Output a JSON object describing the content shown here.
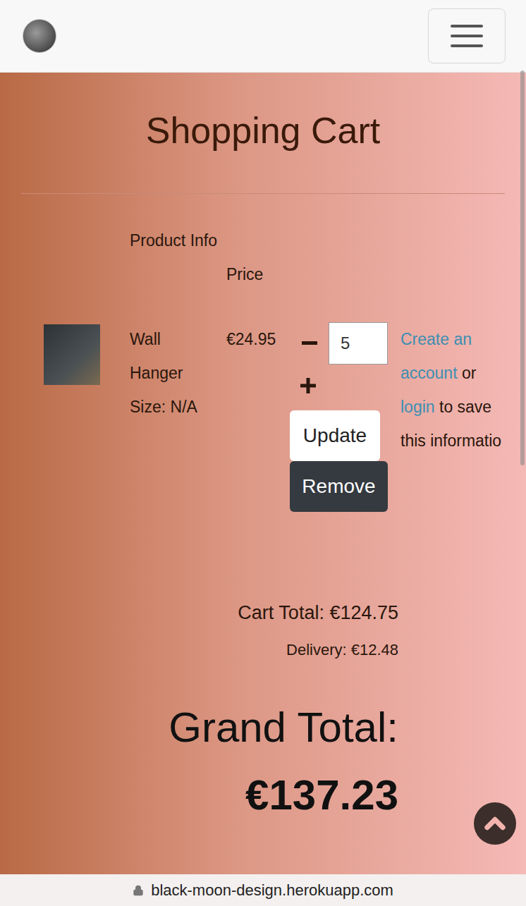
{
  "page": {
    "title": "Shopping Cart"
  },
  "table": {
    "columns": [
      "Product Info",
      "Price"
    ],
    "rows": [
      {
        "name": "Wall Hanger",
        "size": "Size: N/A",
        "price": "€24.95",
        "quantity": "5",
        "update": "Update",
        "remove": "Remove"
      }
    ]
  },
  "save_prompt": {
    "link1": "Create an account",
    "middle": "or",
    "link2": "login",
    "rest": "to save this informatio"
  },
  "totals": {
    "cart_total": "Cart Total: €124.75",
    "delivery": "Delivery: €12.48",
    "grand_total_label": "Grand Total:",
    "grand_total": "€137.23"
  },
  "address_bar": {
    "url": "black-moon-design.herokuapp.com"
  }
}
